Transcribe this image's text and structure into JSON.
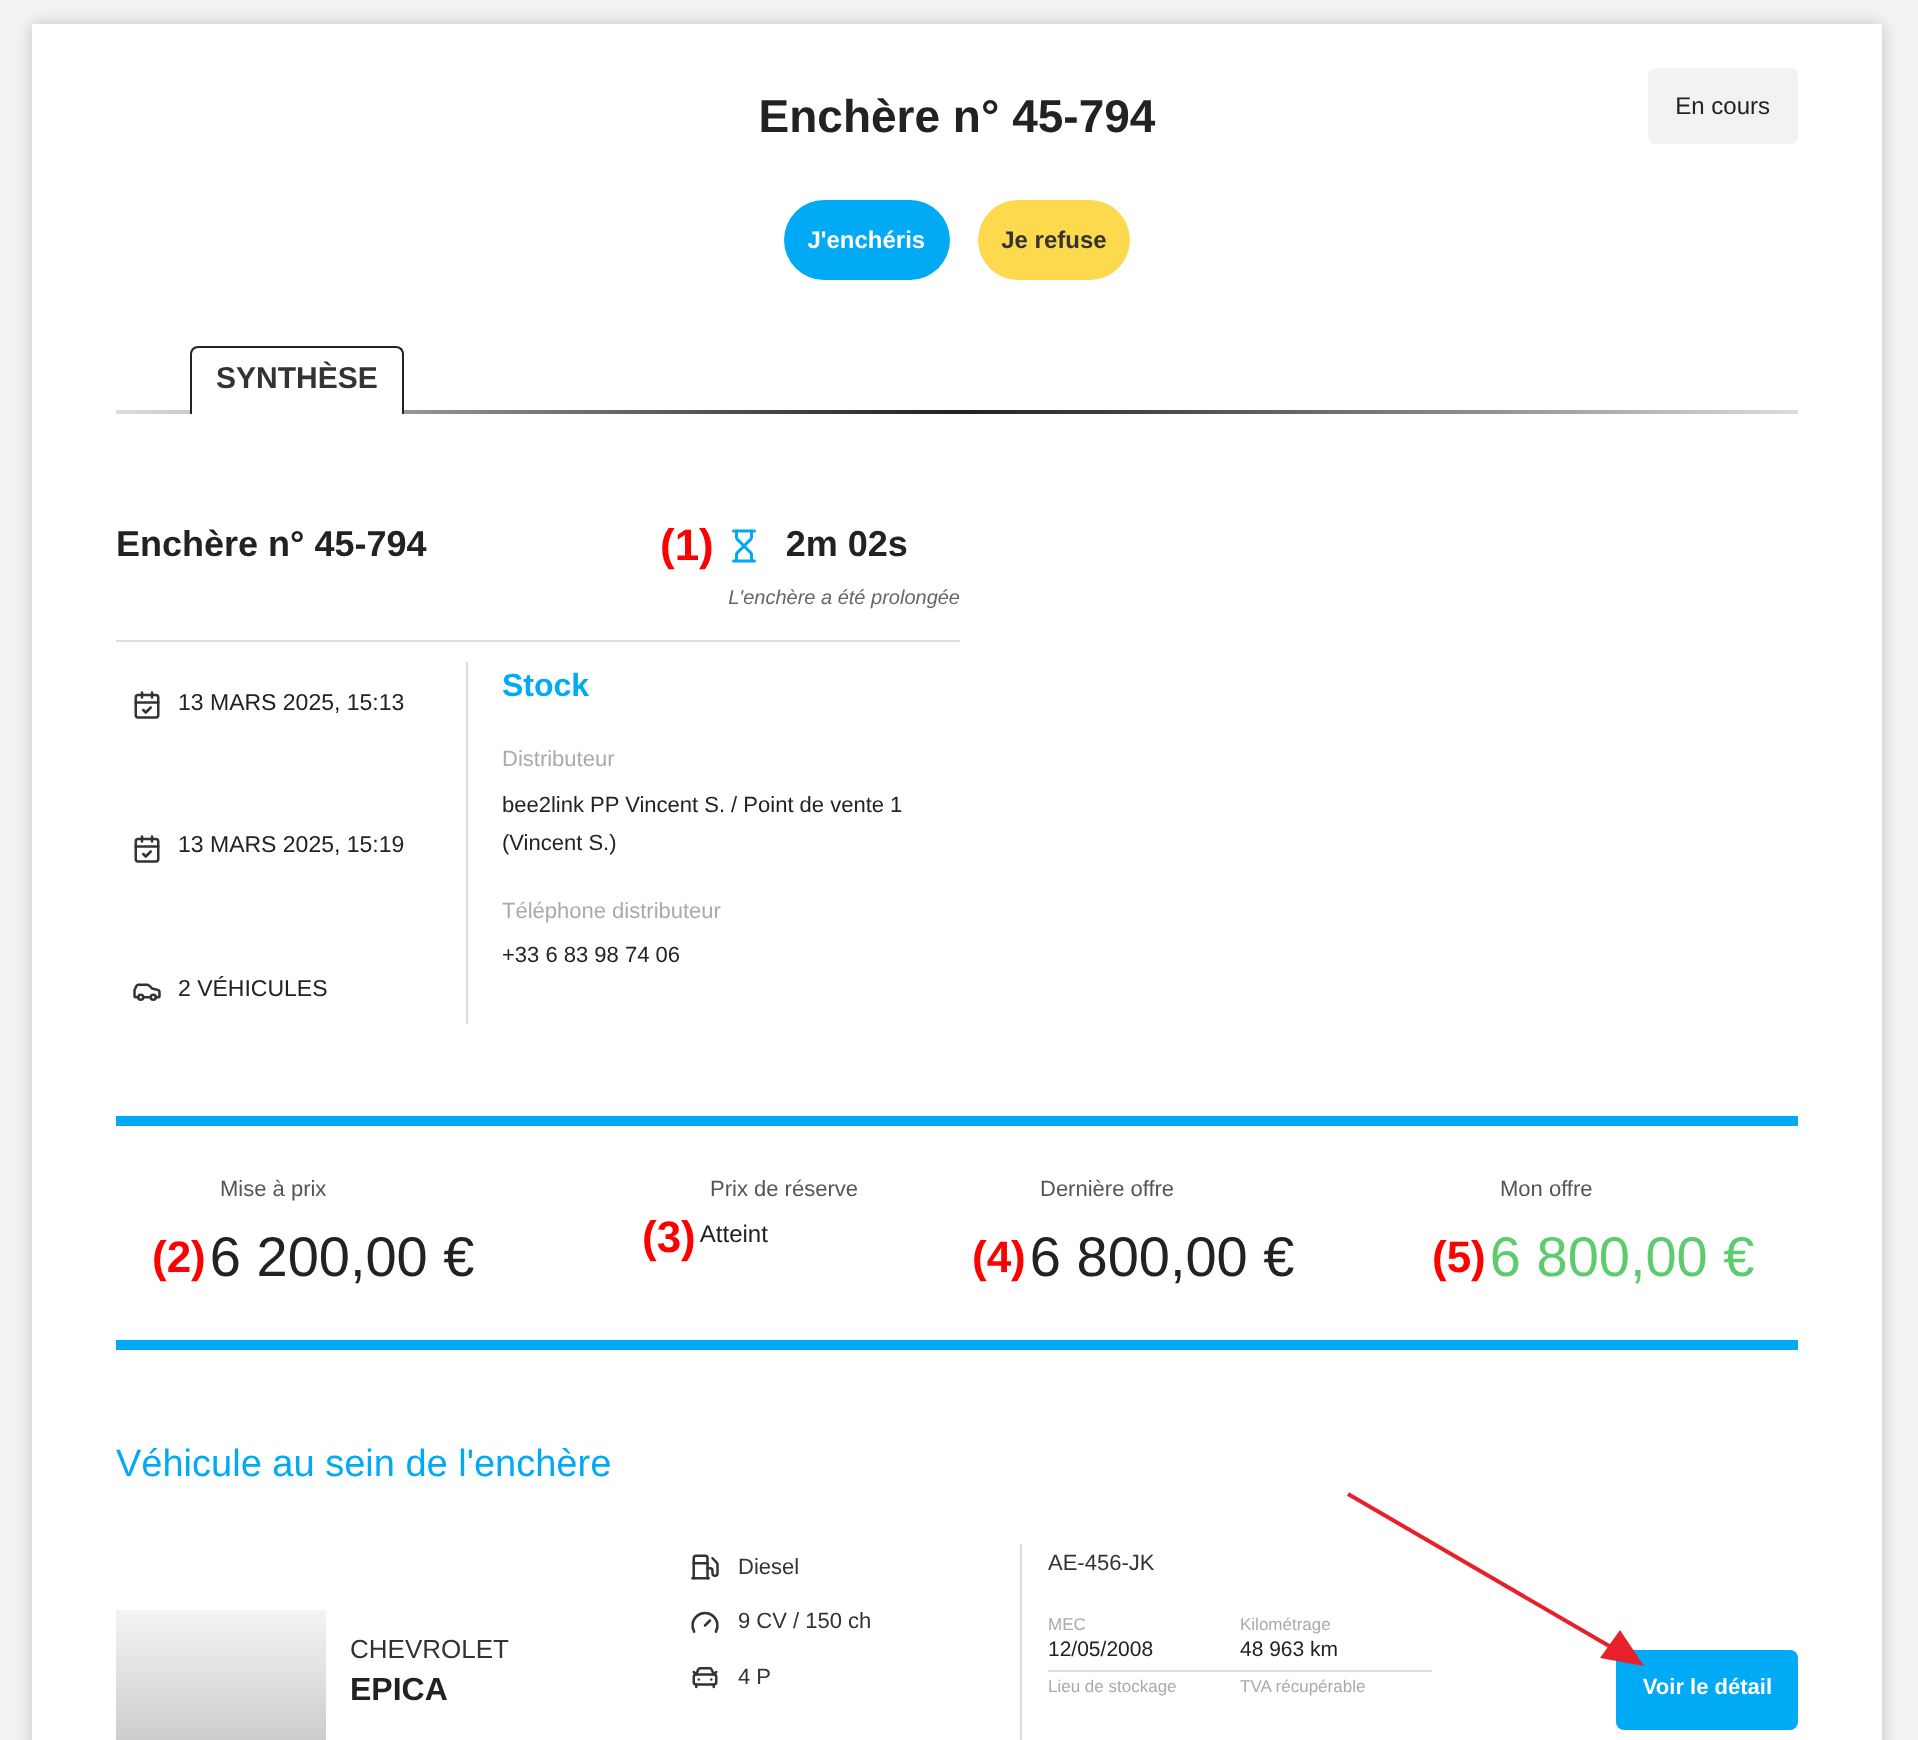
{
  "header": {
    "title": "Enchère n° 45-794",
    "status": "En cours"
  },
  "actions": [
    {
      "label": "J'enchéris",
      "kind": "primary"
    },
    {
      "label": "Je refuse",
      "kind": "secondary"
    }
  ],
  "tabs": [
    {
      "label": "SYNTHÈSE",
      "selected": true
    }
  ],
  "summary": {
    "title": "Enchère n° 45-794",
    "timer_marker": "(1)",
    "timer": "2m 02s",
    "timer_note": "L'enchère a été prolongée",
    "facts": [
      {
        "kind": "date",
        "text": "13 MARS 2025, 15:13"
      },
      {
        "kind": "date",
        "text": "13 MARS 2025, 15:19"
      },
      {
        "kind": "vehicles",
        "text": "2 VÉHICULES"
      }
    ],
    "type": "Stock",
    "fields": [
      {
        "label": "Distributeur",
        "value": "bee2link PP Vincent S. / Point de vente 1 (Vincent S.)"
      },
      {
        "label": "Téléphone distributeur",
        "value": "+33 6 83 98 74 06"
      }
    ]
  },
  "prices": [
    {
      "label": "Mise à prix",
      "marker": "(2)",
      "value": "6 200,00 €",
      "kind": "amount"
    },
    {
      "label": "Prix de réserve",
      "marker": "(3)",
      "value": "Atteint",
      "kind": "status"
    },
    {
      "label": "Dernière offre",
      "marker": "(4)",
      "value": "6 800,00 €",
      "kind": "amount"
    },
    {
      "label": "Mon offre",
      "marker": "(5)",
      "value": "6 800,00 €",
      "kind": "mine"
    }
  ],
  "vehicles_section": {
    "title": "Véhicule au sein de l'enchère",
    "pointer_arrow": true,
    "vehicles": [
      {
        "brand": "CHEVROLET",
        "model": "EPICA",
        "specs": [
          {
            "kind": "fuel",
            "text": "Diesel"
          },
          {
            "kind": "power",
            "text": "9 CV / 150 ch"
          },
          {
            "kind": "doors",
            "text": "4 P"
          }
        ],
        "plate": "AE-456-JK",
        "details": [
          {
            "label": "MEC",
            "value": "12/05/2008"
          },
          {
            "label": "Kilométrage",
            "value": "48 963 km"
          },
          {
            "label": "Lieu de stockage"
          },
          {
            "label": "TVA récupérable"
          }
        ],
        "button": "Voir le détail"
      }
    ]
  }
}
